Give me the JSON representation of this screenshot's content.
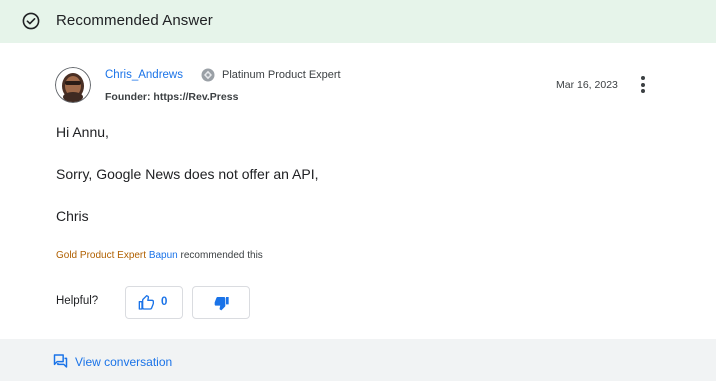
{
  "banner": {
    "title": "Recommended Answer"
  },
  "post": {
    "author": "Chris_Andrews",
    "badge": "Platinum Product Expert",
    "founder": "Founder: https://Rev.Press",
    "date": "Mar 16, 2023",
    "body": [
      "Hi Annu,",
      "Sorry, Google News does not offer an API,",
      "Chris"
    ]
  },
  "recommendation": {
    "expert_title": "Gold Product Expert",
    "expert_name": "Bapun",
    "suffix": "recommended this"
  },
  "helpful": {
    "label": "Helpful?",
    "up_count": "0"
  },
  "footer": {
    "view_conversation": "View conversation"
  },
  "colors": {
    "accent": "#1a73e8",
    "banner_bg": "#e6f4ea",
    "gold": "#b06000",
    "footer_bg": "#f1f3f4"
  }
}
